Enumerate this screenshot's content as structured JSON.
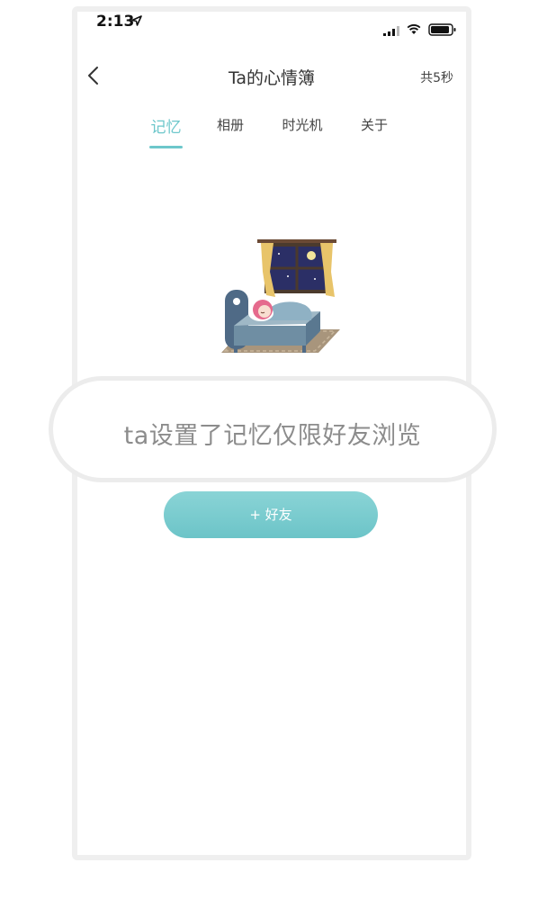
{
  "status_bar": {
    "time": "2:13"
  },
  "nav": {
    "title": "Ta的心情簿",
    "duration": "共5秒"
  },
  "tabs": [
    {
      "label": "记忆",
      "active": true
    },
    {
      "label": "相册",
      "active": false
    },
    {
      "label": "时光机",
      "active": false
    },
    {
      "label": "关于",
      "active": false
    }
  ],
  "toast": {
    "message": "ta设置了记忆仅限好友浏览"
  },
  "actions": {
    "add_friend_label": "+ 好友"
  },
  "colors": {
    "accent": "#6dc7cb",
    "button_gradient_top": "#8ad4d6",
    "button_gradient_bottom": "#6cc4c8",
    "toast_text": "#8c8c8c",
    "frame_border": "#efefef"
  },
  "icons": {
    "back": "chevron-left-icon",
    "location": "location-arrow-icon",
    "signal": "signal-icon",
    "wifi": "wifi-icon",
    "battery": "battery-icon"
  }
}
